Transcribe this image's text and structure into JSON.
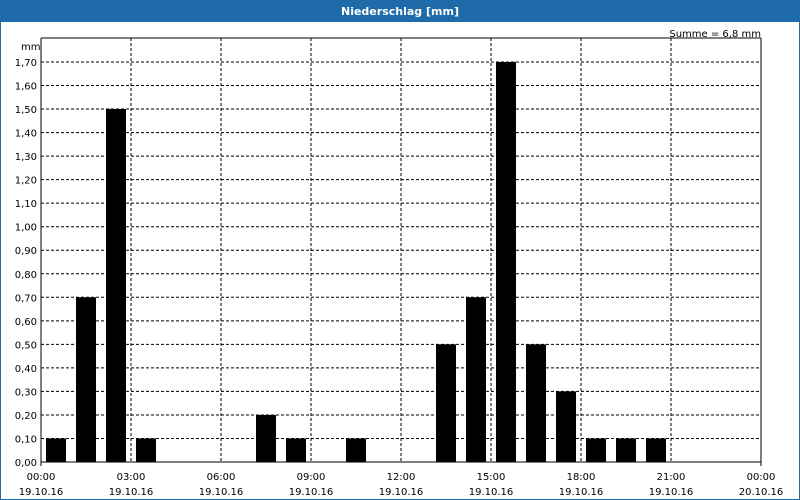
{
  "title": "Niederschlag [mm]",
  "sum_label": "Summe = 6,8 mm",
  "y_unit": "mm",
  "colors": {
    "titlebar": "#1f6aa8",
    "bar": "#000000",
    "grid": "#000000"
  },
  "chart_data": {
    "type": "bar",
    "title": "Niederschlag [mm]",
    "ylabel": "mm",
    "ylim": [
      0,
      1.8
    ],
    "grid": true,
    "x_ticks": [
      {
        "time": "00:00",
        "date": "19.10.16"
      },
      {
        "time": "03:00",
        "date": "19.10.16"
      },
      {
        "time": "06:00",
        "date": "19.10.16"
      },
      {
        "time": "09:00",
        "date": "19.10.16"
      },
      {
        "time": "12:00",
        "date": "19.10.16"
      },
      {
        "time": "15:00",
        "date": "19.10.16"
      },
      {
        "time": "18:00",
        "date": "19.10.16"
      },
      {
        "time": "21:00",
        "date": "19.10.16"
      },
      {
        "time": "00:00",
        "date": "20.10.16"
      }
    ],
    "y_ticks": [
      "0,00",
      "0,10",
      "0,20",
      "0,30",
      "0,40",
      "0,50",
      "0,60",
      "0,70",
      "0,80",
      "0,90",
      "1,00",
      "1,10",
      "1,20",
      "1,30",
      "1,40",
      "1,50",
      "1,60",
      "1,70"
    ],
    "categories": [
      "00:00",
      "01:00",
      "02:00",
      "03:00",
      "04:00",
      "05:00",
      "06:00",
      "07:00",
      "08:00",
      "09:00",
      "10:00",
      "11:00",
      "12:00",
      "13:00",
      "14:00",
      "15:00",
      "16:00",
      "17:00",
      "18:00",
      "19:00",
      "20:00",
      "21:00",
      "22:00",
      "23:00"
    ],
    "values": [
      0.1,
      0.7,
      1.5,
      0.1,
      0,
      0,
      0,
      0.2,
      0.1,
      0,
      0.1,
      0,
      0,
      0.5,
      0.7,
      1.7,
      0.5,
      0.3,
      0.1,
      0.1,
      0.1,
      0,
      0,
      0
    ]
  }
}
